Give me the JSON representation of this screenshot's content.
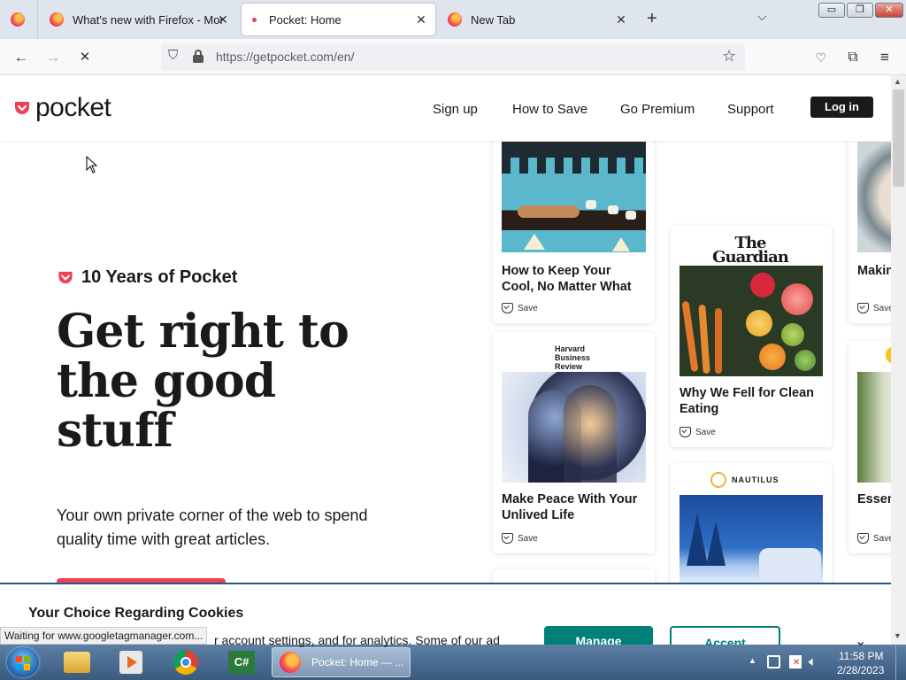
{
  "browser": {
    "tabs": [
      {
        "title": "What's new with Firefox - More",
        "active": false
      },
      {
        "title": "Pocket: Home",
        "active": true
      },
      {
        "title": "New Tab",
        "active": false
      }
    ],
    "new_tab_symbol": "+",
    "url": "https://getpocket.com/en/"
  },
  "header": {
    "logo_text": "pocket",
    "nav": [
      "Sign up",
      "How to Save",
      "Go Premium",
      "Support"
    ],
    "login": "Log in"
  },
  "hero": {
    "eyebrow": "10 Years of Pocket",
    "headline": "Get right to the good stuff",
    "subtext": "Your own private corner of the web to spend quality time with great articles."
  },
  "cards": [
    {
      "title": "How to Keep Your Cool, No Matter What",
      "save": "Save"
    },
    {
      "title": "Make Peace With Your Unlived Life",
      "save": "Save",
      "publisher": "Harvard Business Review"
    },
    {
      "title": "Why We Fell for Clean Eating",
      "save": "Save",
      "publisher": "The Guardian"
    },
    {
      "title": "",
      "save": "",
      "publisher": "NAUTILUS"
    },
    {
      "title": "Makin Stuff",
      "save": "Save"
    },
    {
      "title": "Essen Well-",
      "save": "Save"
    }
  ],
  "cookie": {
    "title": "Your Choice Regarding Cookies",
    "text": "r account settings, and for analytics. Some of our ad",
    "manage": "Manage",
    "accept": "Accept"
  },
  "status": "Waiting for www.googletagmanager.com...",
  "taskbar": {
    "window_label": "Pocket: Home — ...",
    "time": "11:58 PM",
    "date": "2/28/2023"
  },
  "colors": {
    "pocket_red": "#ef4056",
    "dark": "#1a1a1a",
    "cookie_green": "#008078"
  }
}
